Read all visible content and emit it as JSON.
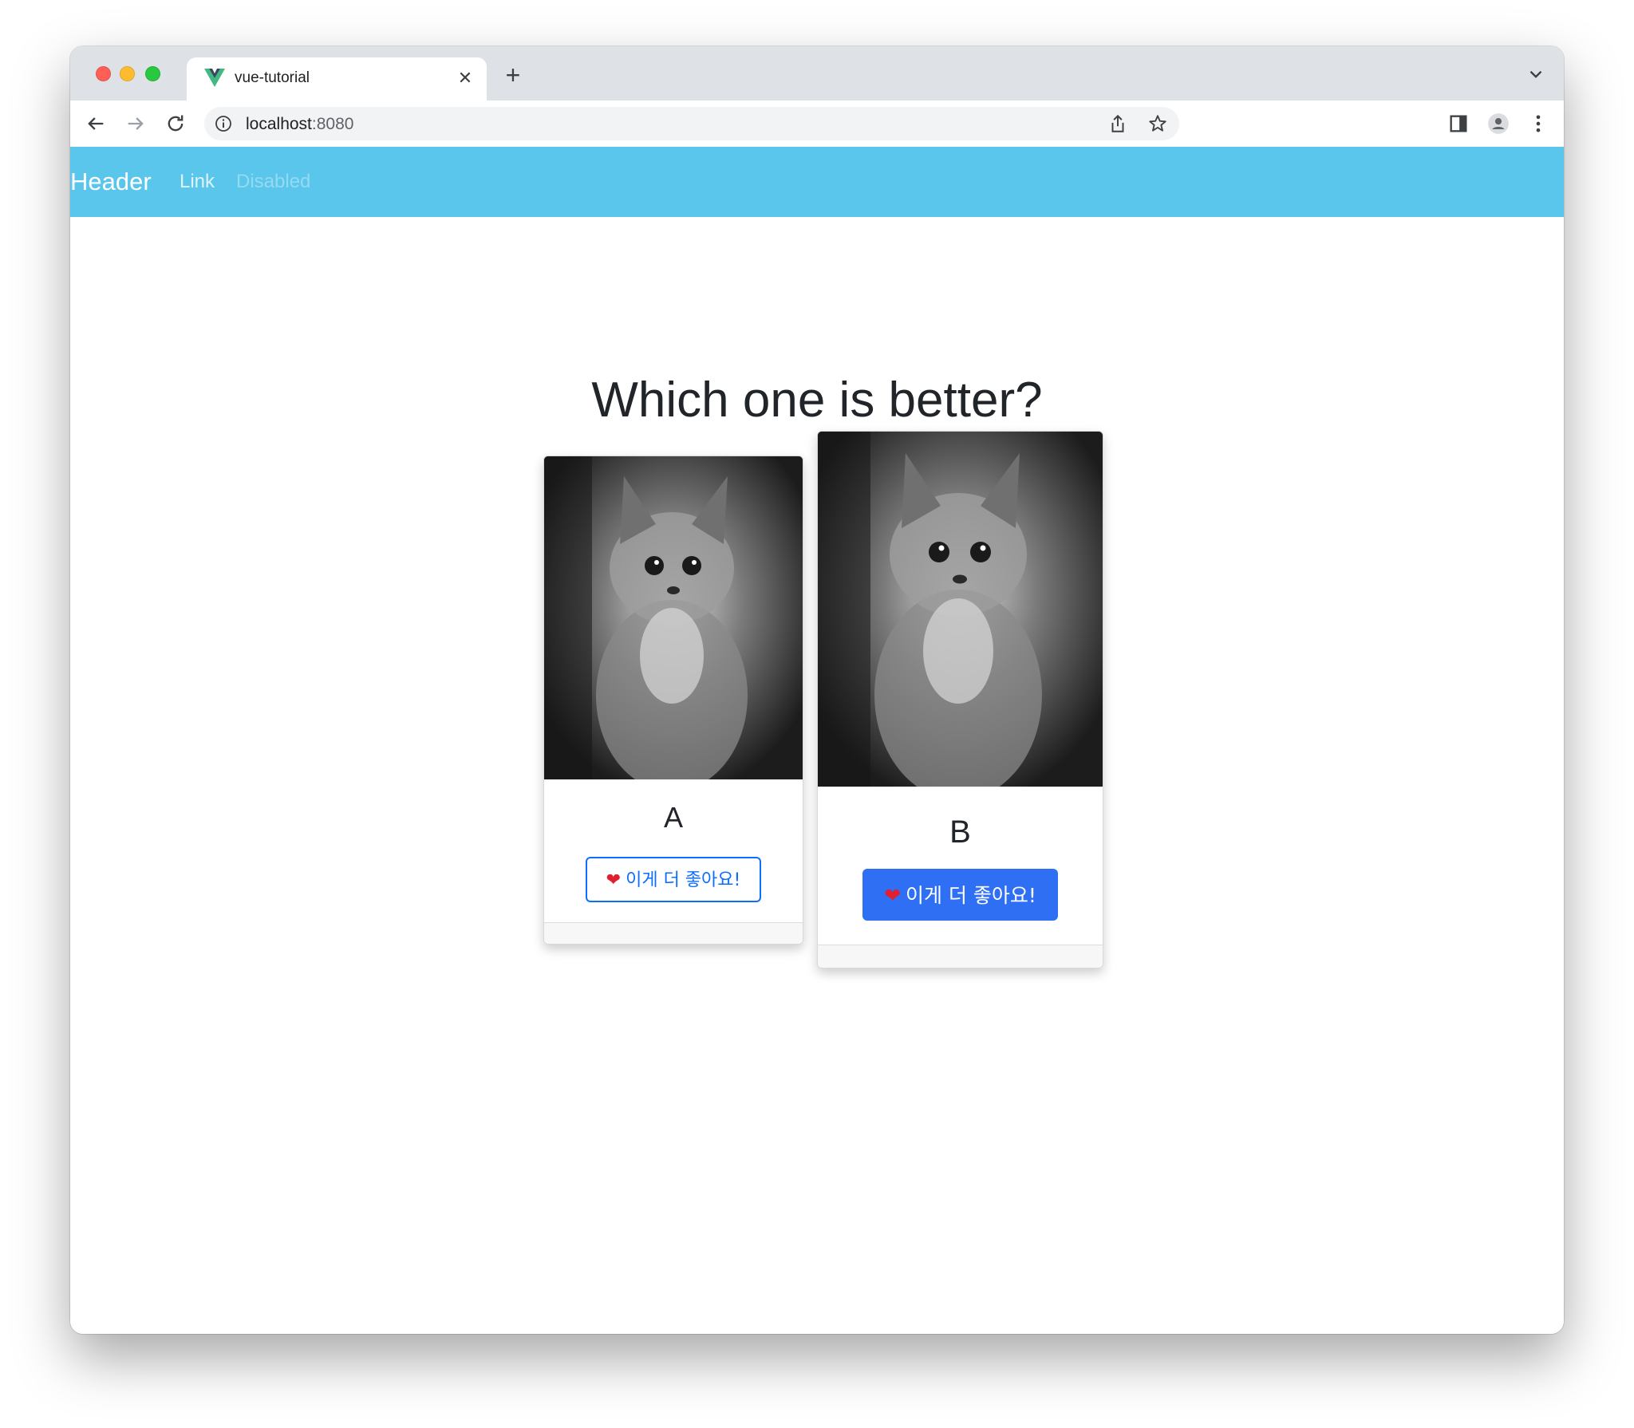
{
  "browser": {
    "tab_title": "vue-tutorial",
    "tab_close_icon": "close-icon",
    "new_tab_symbol": "+",
    "url_host": "localhost",
    "url_port": ":8080"
  },
  "navbar": {
    "brand": "Header",
    "links": [
      "Link",
      "Disabled"
    ],
    "background": "#5bc6eb"
  },
  "main": {
    "question": "Which one is better?",
    "cards": [
      {
        "title": "A",
        "button_label": "이게 더 좋아요!",
        "button_style": "outline"
      },
      {
        "title": "B",
        "button_label": "이게 더 좋아요!",
        "button_style": "solid"
      }
    ],
    "heart_icon": "❤️",
    "accent": "#0d6efd"
  }
}
